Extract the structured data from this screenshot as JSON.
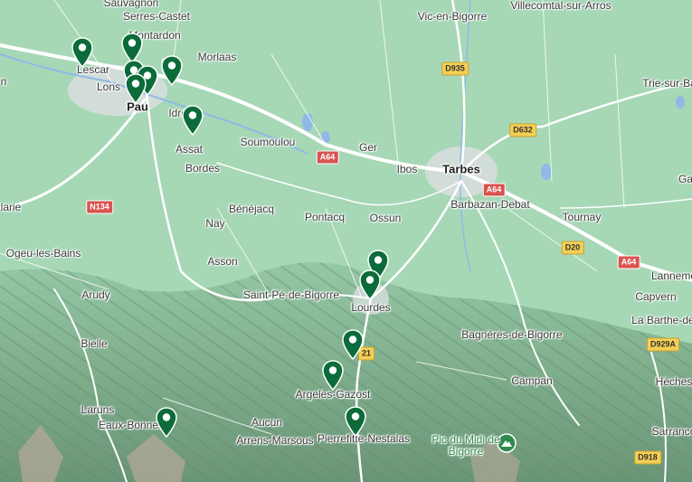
{
  "places": [
    {
      "label": "Sauvagnon",
      "big": false
    },
    {
      "label": "Serres-Castet",
      "big": false
    },
    {
      "label": "Montardon",
      "big": false
    },
    {
      "label": "Morlaas",
      "big": false
    },
    {
      "label": "Lescar",
      "big": false
    },
    {
      "label": "Lons",
      "big": false
    },
    {
      "label": "Pau",
      "big": true
    },
    {
      "label": "Idron",
      "big": false
    },
    {
      "label": "Assat",
      "big": false
    },
    {
      "label": "Bordes",
      "big": false
    },
    {
      "label": "Soumoulou",
      "big": false
    },
    {
      "label": "Ger",
      "big": false
    },
    {
      "label": "Ibos",
      "big": false
    },
    {
      "label": "Tarbes",
      "big": true
    },
    {
      "label": "Barbazan-Debat",
      "big": false
    },
    {
      "label": "Tournay",
      "big": false
    },
    {
      "label": "Vic-en-Bigorre",
      "big": false
    },
    {
      "label": "Villecomtal-sur-Arros",
      "big": false
    },
    {
      "label": "Trie-sur-Ba",
      "big": false
    },
    {
      "label": "Ga",
      "big": false
    },
    {
      "label": "Lanneme",
      "big": false
    },
    {
      "label": "Capvern",
      "big": false
    },
    {
      "label": "La Barthe-de-",
      "big": false
    },
    {
      "label": "Bagnères-de-Bigorre",
      "big": false
    },
    {
      "label": "Campan",
      "big": false
    },
    {
      "label": "Hèches",
      "big": false
    },
    {
      "label": "Sarranco",
      "big": false
    },
    {
      "label": "Bénéjacq",
      "big": false
    },
    {
      "label": "Pontacq",
      "big": false
    },
    {
      "label": "Ossun",
      "big": false
    },
    {
      "label": "Nay",
      "big": false
    },
    {
      "label": "Asson",
      "big": false
    },
    {
      "label": "Saint-Pé-de-Bigorre",
      "big": false
    },
    {
      "label": "Lourdes",
      "big": false
    },
    {
      "label": "Arudy",
      "big": false
    },
    {
      "label": "Bielle",
      "big": false
    },
    {
      "label": "Laruns",
      "big": false
    },
    {
      "label": "Eaux-Bonnes",
      "big": false
    },
    {
      "label": "Aucun",
      "big": false
    },
    {
      "label": "Arrens-Marsous",
      "big": false
    },
    {
      "label": "Argelès-Gazost",
      "big": false
    },
    {
      "label": "Pierrefitte-Nestalas",
      "big": false
    },
    {
      "label": "Ogeu-les-Bains",
      "big": false
    },
    {
      "label": "larie",
      "big": false
    },
    {
      "label": "n",
      "big": false
    }
  ],
  "peak": {
    "label": "Pic du Midi de Bigorre",
    "icon": "mountain-peak-icon",
    "color": "#2f8a4d"
  },
  "roads": [
    {
      "label": "D935",
      "style": "yellow"
    },
    {
      "label": "D632",
      "style": "yellow"
    },
    {
      "label": "A64",
      "style": "red"
    },
    {
      "label": "A64",
      "style": "red"
    },
    {
      "label": "A64",
      "style": "red"
    },
    {
      "label": "N134",
      "style": "red"
    },
    {
      "label": "D20",
      "style": "yellow"
    },
    {
      "label": "D929A",
      "style": "yellow"
    },
    {
      "label": "D918",
      "style": "yellow"
    },
    {
      "label": "21",
      "style": "yellow"
    },
    {
      "label": "A",
      "style": "red"
    }
  ],
  "markers": {
    "count": 13,
    "color": "#0b6b3a",
    "icon": "map-pin-icon"
  },
  "colors": {
    "lowland": "#a6d8b6",
    "mountain": "#6f9d7d",
    "urban": "#d7dedd",
    "road": "#ffffff",
    "water": "#8fb9e6"
  }
}
